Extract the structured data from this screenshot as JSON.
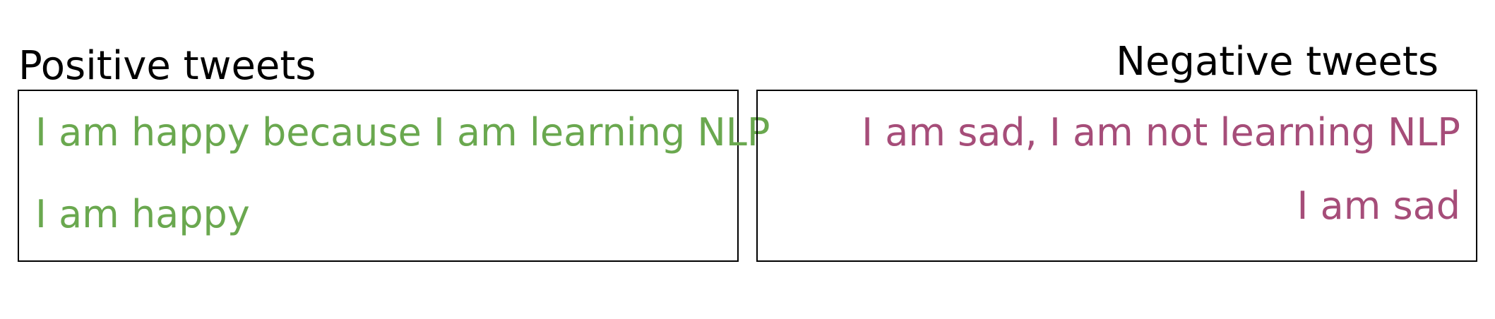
{
  "positive": {
    "heading": "Positive tweets",
    "color": "#6aa84f",
    "tweets": [
      "I am happy because I am learning NLP",
      "I am happy"
    ]
  },
  "negative": {
    "heading": "Negative  tweets",
    "color": "#a64d79",
    "tweets": [
      "I am sad, I am not learning NLP",
      "I am sad"
    ]
  }
}
